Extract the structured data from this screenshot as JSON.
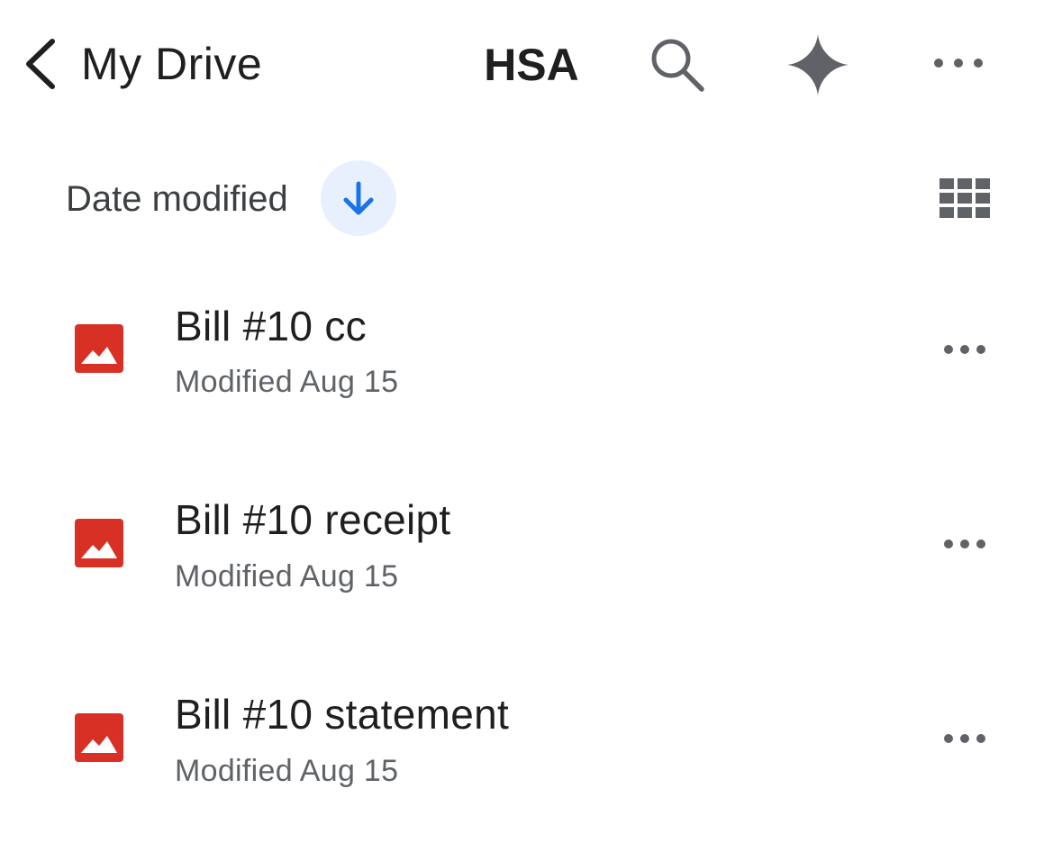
{
  "header": {
    "back_label": "My Drive",
    "title": "HSA",
    "back_icon": "chevron-left-icon",
    "search_icon": "search-icon",
    "gemini_icon": "gemini-sparkle-icon",
    "more_icon": "more-horizontal-icon"
  },
  "sort": {
    "label": "Date modified",
    "direction_icon": "arrow-down-icon",
    "view_icon": "grid-view-icon"
  },
  "files": [
    {
      "name": "Bill #10 cc",
      "meta": "Modified Aug 15",
      "icon": "image-file-icon"
    },
    {
      "name": "Bill #10 receipt",
      "meta": "Modified Aug 15",
      "icon": "image-file-icon"
    },
    {
      "name": "Bill #10 statement",
      "meta": "Modified Aug 15",
      "icon": "image-file-icon"
    }
  ],
  "colors": {
    "accent": "#1a73e8",
    "accent_bg": "#e8f0fe",
    "file_icon_red": "#d93025",
    "icon_gray": "#5f6368",
    "text_primary": "#1f1f1f",
    "text_secondary": "#5f6368"
  }
}
